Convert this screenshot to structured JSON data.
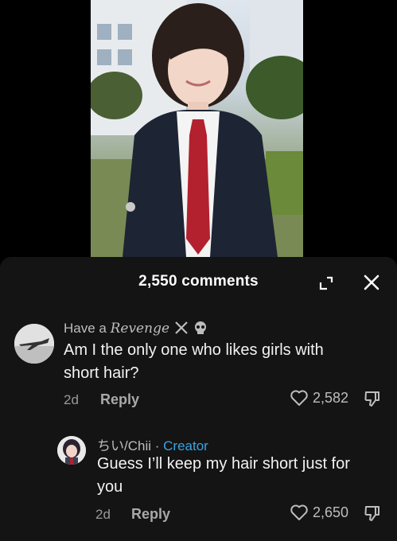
{
  "video": {
    "alt_desc": "video-frame"
  },
  "panel": {
    "comment_count": "2,550 comments"
  },
  "comments": [
    {
      "author_plain": "Have a ",
      "author_styled": "Revenge",
      "text_line1": "Am I the only one who likes girls with",
      "text_line2": "short hair?",
      "age": "2d",
      "reply_label": "Reply",
      "likes": "2,582"
    },
    {
      "author": "ちい/Chii",
      "separator": " · ",
      "badge": "Creator",
      "text_line1": "Guess I’ll keep my hair short just for",
      "text_line2": "you",
      "age": "2d",
      "reply_label": "Reply",
      "likes": "2,650"
    }
  ],
  "colors": {
    "panel_bg": "#141414",
    "creator_badge": "#3aa3e0"
  }
}
